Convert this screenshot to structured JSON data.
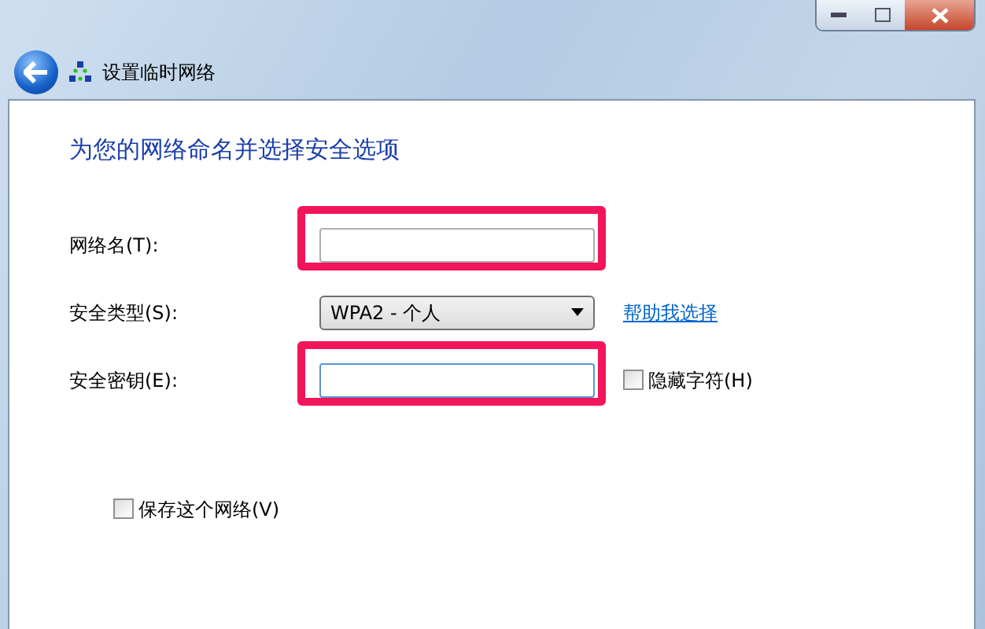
{
  "window": {
    "title": "设置临时网络"
  },
  "heading": "为您的网络命名并选择安全选项",
  "fields": [
    {
      "kind": "text",
      "label": "网络名(T):",
      "highlighted": true
    },
    {
      "kind": "select",
      "label": "安全类型(S):",
      "value": "WPA2 - 个人",
      "link": "帮助我选择"
    },
    {
      "kind": "password",
      "label": "安全密钥(E):",
      "highlighted": true,
      "checkbox": {
        "label": "隐藏字符(H)",
        "checked": false
      }
    }
  ],
  "save_checkbox": {
    "label": "保存这个网络(V)",
    "checked": false
  }
}
